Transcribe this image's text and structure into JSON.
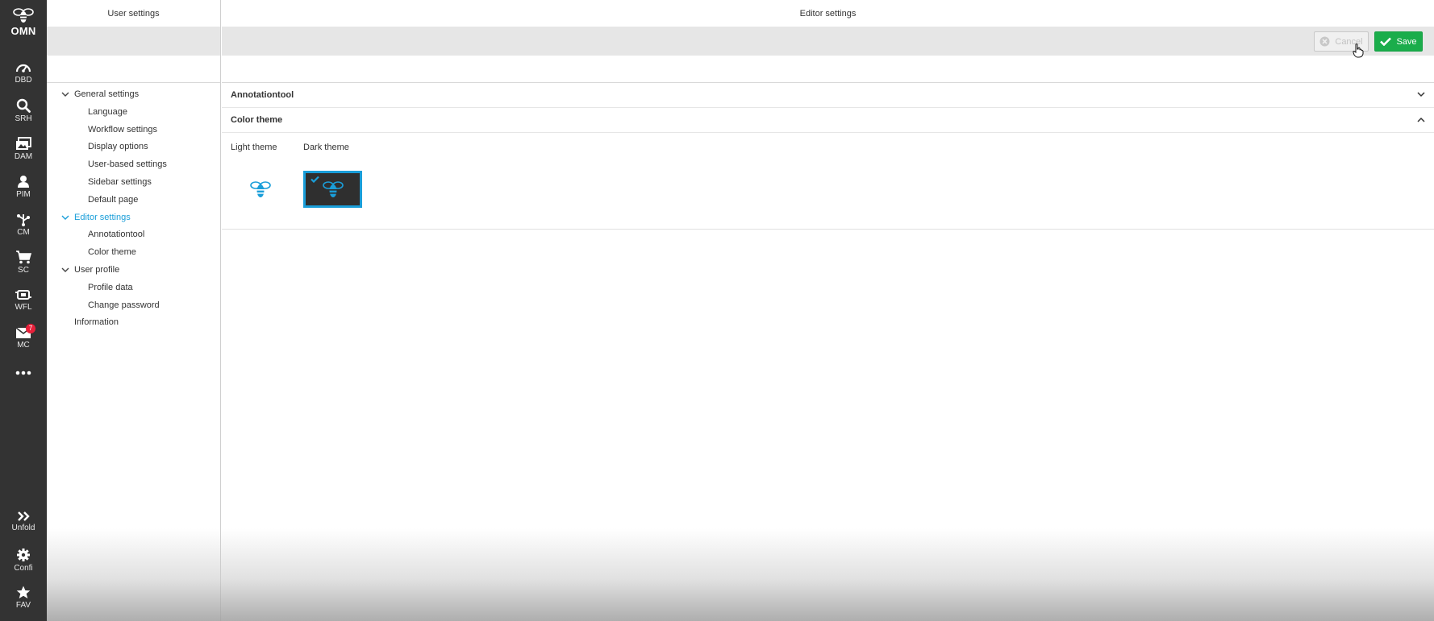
{
  "rail": {
    "logo_label": "OMN",
    "items": [
      {
        "label": "DBD",
        "icon": "dashboard-icon"
      },
      {
        "label": "SRH",
        "icon": "search-icon"
      },
      {
        "label": "DAM",
        "icon": "images-icon"
      },
      {
        "label": "PIM",
        "icon": "product-icon"
      },
      {
        "label": "CM",
        "icon": "network-icon"
      },
      {
        "label": "SC",
        "icon": "cart-icon"
      },
      {
        "label": "WFL",
        "icon": "workflow-icon"
      },
      {
        "label": "MC",
        "icon": "mail-icon",
        "badge": "7"
      }
    ],
    "more_icon": "more-icon",
    "bottom_items": [
      {
        "label": "Unfold",
        "icon": "double-chevron-right-icon"
      },
      {
        "label": "Confi",
        "icon": "gear-icon"
      },
      {
        "label": "FAV",
        "icon": "star-icon"
      }
    ]
  },
  "nav": {
    "title": "User settings",
    "tree": [
      {
        "label": "General settings",
        "level": 0,
        "expanded": true
      },
      {
        "label": "Language",
        "level": 1
      },
      {
        "label": "Workflow settings",
        "level": 1
      },
      {
        "label": "Display options",
        "level": 1
      },
      {
        "label": "User-based settings",
        "level": 1
      },
      {
        "label": "Sidebar settings",
        "level": 1
      },
      {
        "label": "Default page",
        "level": 1
      },
      {
        "label": "Editor settings",
        "level": 0,
        "expanded": true,
        "active": true
      },
      {
        "label": "Annotationtool",
        "level": 1
      },
      {
        "label": "Color theme",
        "level": 1
      },
      {
        "label": "User profile",
        "level": 0,
        "expanded": true
      },
      {
        "label": "Profile data",
        "level": 1
      },
      {
        "label": "Change password",
        "level": 1
      },
      {
        "label": "Information",
        "level": 0
      }
    ]
  },
  "main": {
    "title": "Editor settings",
    "toolbar": {
      "cancel_label": "Cancel",
      "save_label": "Save"
    },
    "sections": [
      {
        "title": "Annotationtool",
        "expanded": false
      },
      {
        "title": "Color theme",
        "expanded": true
      }
    ],
    "color_theme": {
      "light_label": "Light theme",
      "dark_label": "Dark theme",
      "selected": "dark"
    }
  },
  "colors": {
    "accent": "#1a9ed9",
    "save_green": "#1aad4b",
    "rail_bg": "#333333",
    "badge_red": "#e8203a"
  }
}
